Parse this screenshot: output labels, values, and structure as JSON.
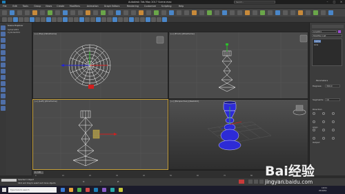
{
  "window": {
    "title": "Autodesk 3ds Max 2017    Scene.max",
    "search_value": "Search..."
  },
  "menu": {
    "items": [
      "File",
      "Edit",
      "Tools",
      "Group",
      "Views",
      "Create",
      "Modifiers",
      "Animation",
      "Graph Editors",
      "Rendering",
      "Customize",
      "Scripting",
      "Help"
    ]
  },
  "viewports": {
    "top": "[+] [Top] [Wireframe]",
    "front": "[+] [Front] [Wireframe]",
    "left": "[+] [Left] [Wireframe]",
    "perspective": "[+] [Perspective] [Realistic]"
  },
  "scene_explorer": {
    "header": "Scene Explorer",
    "items": [
      "Sphere001",
      "Cylinder001"
    ]
  },
  "command_panel": {
    "object_name": "Line001",
    "modifier_list": "Modifier List",
    "stack_items": [
      "Lathe",
      "Line"
    ],
    "rollout_params": "Parameters",
    "degrees_label": "Degrees:",
    "degrees_value": "360.0",
    "segments_label": "Segments:",
    "segments_value": "16",
    "direction_label": "Direction",
    "align_label": "Align",
    "output_label": "Output"
  },
  "timeline": {
    "frame_display": "0 / 100",
    "ticks": [
      "0",
      "10",
      "20",
      "30",
      "40",
      "50",
      "60",
      "70",
      "80",
      "90",
      "100"
    ]
  },
  "status": {
    "selection": "Selected 1 Object",
    "prompt": "Click and drag to select and move objects",
    "x_label": "X:",
    "y_label": "Y:",
    "z_label": "Z:"
  },
  "taskbar": {
    "search_placeholder": "Type here to search",
    "time": "19:01",
    "date": "2019/5/1"
  },
  "watermark": {
    "brand": "Bai经验",
    "site": "jingyan.baidu.com"
  },
  "colors": {
    "selected_object": "#2d2bd6",
    "wireframe": "#ffffff",
    "gizmo_x": "#d11f1f",
    "gizmo_y": "#2bbf2b",
    "gizmo_z": "#2222d8",
    "active_border": "#c8a23a"
  }
}
